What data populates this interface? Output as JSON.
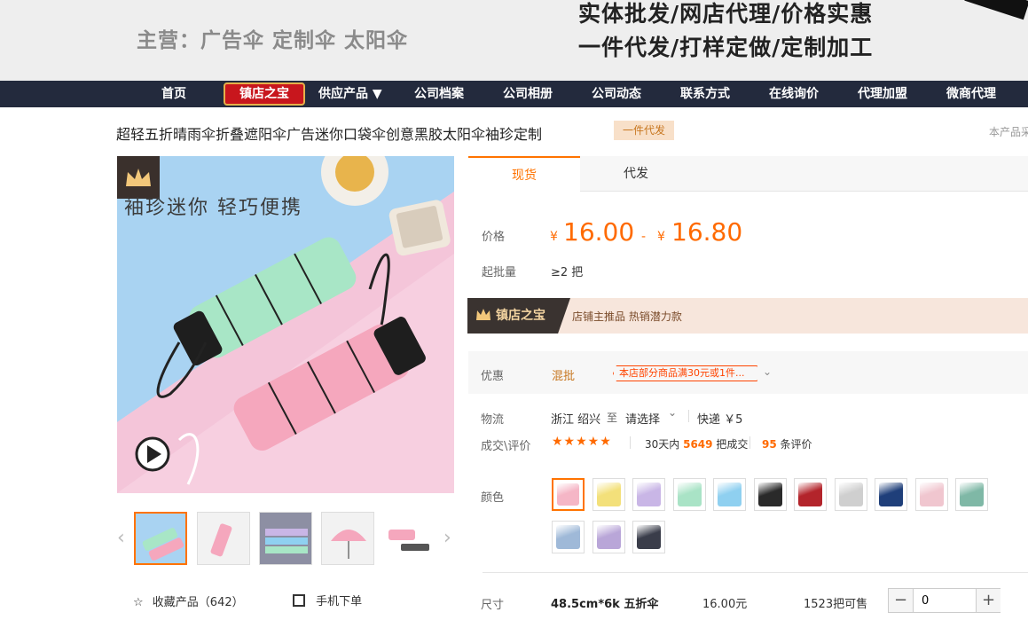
{
  "banner": {
    "tagline": "主营：广告伞  定制伞  太阳伞",
    "slogan1": "实体批发/网店代理/价格实惠",
    "slogan2": "一件代发/打样定做/定制加工"
  },
  "nav": {
    "items": [
      "首页",
      "供应产品 ▼",
      "公司档案",
      "公司相册",
      "公司动态",
      "联系方式",
      "在线询价",
      "代理加盟",
      "微商代理"
    ],
    "badge": "镇店之宝"
  },
  "product": {
    "title": "超轻五折晴雨伞折叠遮阳伞广告迷你口袋伞创意黑胶太阳伞袖珍定制",
    "tag": "一件代发",
    "right_note": "本产品采",
    "image_caption": "袖珍迷你  轻巧便携"
  },
  "actions": {
    "favorite": "收藏产品（642）",
    "mobile": "手机下单"
  },
  "tabs": [
    "现货",
    "代发"
  ],
  "price": {
    "label": "价格",
    "yen": "¥",
    "low": "16.00",
    "dash": "-",
    "high": "16.80"
  },
  "moq": {
    "label": "起批量",
    "value": "≥2 把"
  },
  "store": {
    "badge": "镇店之宝",
    "text": "店铺主推品  热销潜力款"
  },
  "promo": {
    "label": "优惠",
    "type": "混批",
    "pill": "本店部分商品满30元或1件..."
  },
  "logistics": {
    "label": "物流",
    "from": "浙江 绍兴",
    "to": "至",
    "select": "请选择",
    "express": "快递 ￥5"
  },
  "deal": {
    "label": "成交\\评价",
    "stars": "★★★★★",
    "period": "30天内",
    "count": "5649",
    "unit": "把成交",
    "reviews": "95",
    "reviews_unit": "条评价"
  },
  "color": {
    "label": "颜色",
    "swatches": [
      "#f5b6c6",
      "#f3e07a",
      "#c9b6e6",
      "#a9e3c6",
      "#8fd0f0",
      "#2a2a2a",
      "#b3242b",
      "#cfcfcf",
      "#1f3f7a",
      "#f0c6cf",
      "#7fb8a6",
      "#9fb9d8",
      "#b9a6d8",
      "#3a3d4a"
    ]
  },
  "size": {
    "label": "尺寸",
    "name": "48.5cm*6k 五折伞",
    "price": "16.00元",
    "stock": "1523把可售",
    "qty": "0",
    "minus": "−",
    "plus": "+"
  }
}
